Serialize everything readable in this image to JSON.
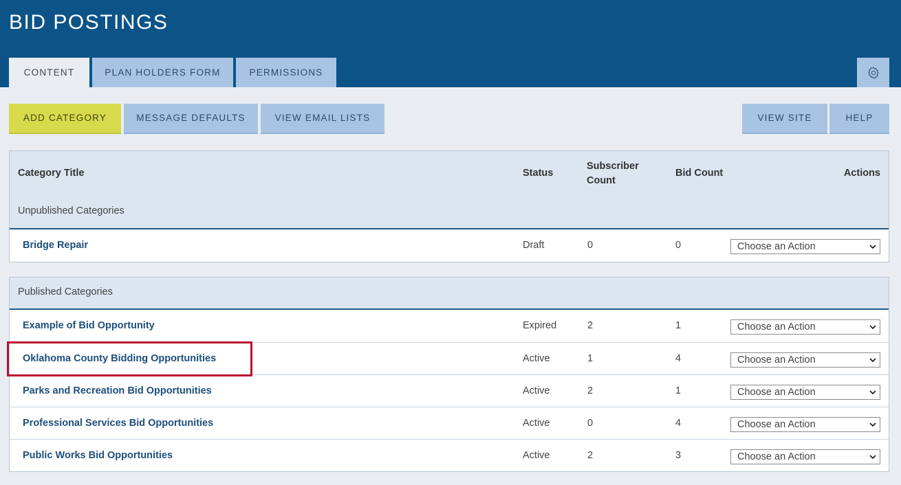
{
  "header": {
    "title": "BID POSTINGS"
  },
  "tabs": [
    {
      "label": "CONTENT",
      "active": true
    },
    {
      "label": "PLAN HOLDERS FORM",
      "active": false
    },
    {
      "label": "PERMISSIONS",
      "active": false
    }
  ],
  "settings_icon": "gear-icon",
  "toolbar": {
    "add_category": "ADD CATEGORY",
    "message_defaults": "MESSAGE DEFAULTS",
    "view_email_lists": "VIEW EMAIL LISTS",
    "view_site": "VIEW SITE",
    "help": "HELP"
  },
  "table": {
    "columns": {
      "title": "Category Title",
      "status": "Status",
      "subscriber_count_line1": "Subscriber",
      "subscriber_count_line2": "Count",
      "bid_count": "Bid Count",
      "actions": "Actions"
    },
    "action_placeholder": "Choose an Action"
  },
  "unpublished": {
    "label": "Unpublished Categories",
    "rows": [
      {
        "title": "Bridge Repair",
        "status": "Draft",
        "subscribers": "0",
        "bids": "0"
      }
    ]
  },
  "published": {
    "label": "Published Categories",
    "rows": [
      {
        "title": "Example of Bid Opportunity",
        "status": "Expired",
        "subscribers": "2",
        "bids": "1"
      },
      {
        "title": "Oklahoma County Bidding Opportunities",
        "status": "Active",
        "subscribers": "1",
        "bids": "4"
      },
      {
        "title": "Parks and Recreation Bid Opportunities",
        "status": "Active",
        "subscribers": "2",
        "bids": "1"
      },
      {
        "title": "Professional Services Bid Opportunities",
        "status": "Active",
        "subscribers": "0",
        "bids": "4"
      },
      {
        "title": "Public Works Bid Opportunities",
        "status": "Active",
        "subscribers": "2",
        "bids": "3"
      }
    ]
  },
  "colors": {
    "header_bg": "#0c5388",
    "tab_bg": "#a9c4e3",
    "primary_button": "#d7da4b",
    "link": "#1d4f7c",
    "highlight": "#b8112f"
  }
}
